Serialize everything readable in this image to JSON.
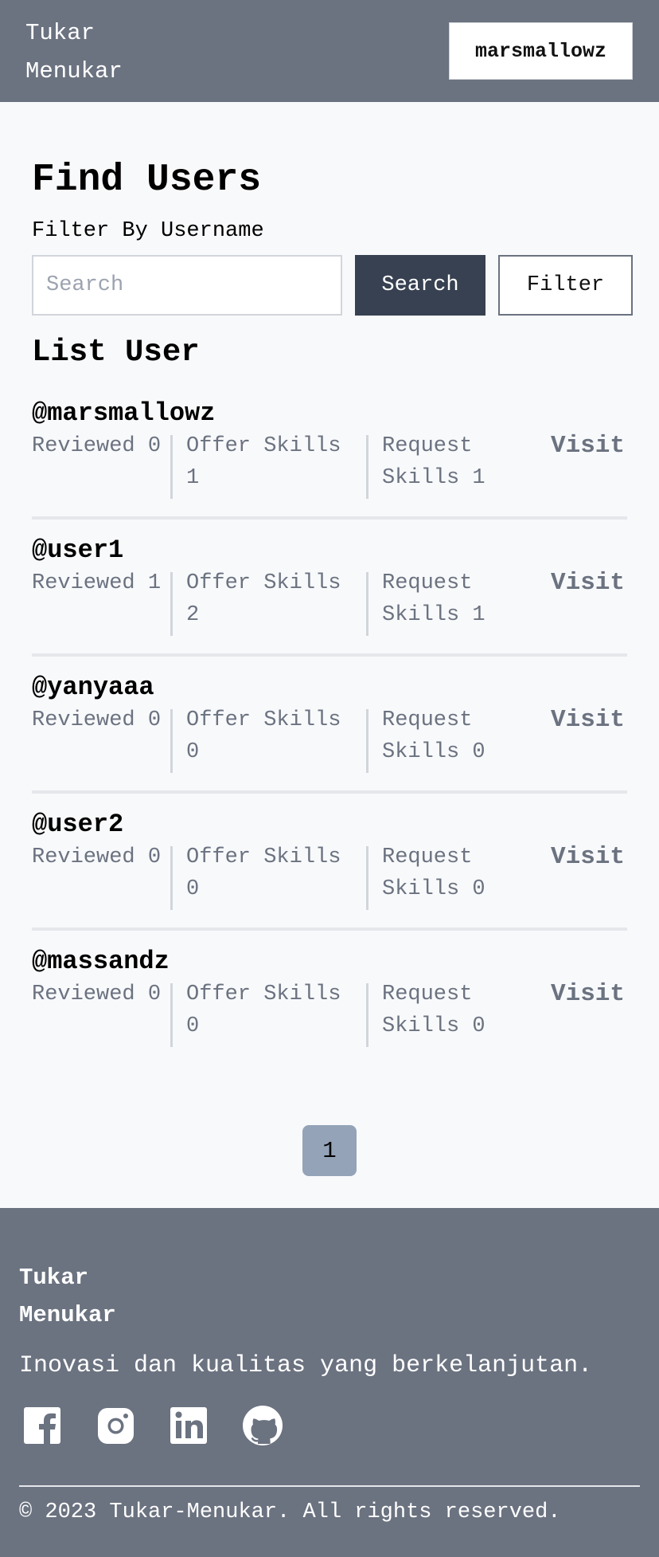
{
  "header": {
    "brand": "Tukar Menukar",
    "user_button": "marsmallowz"
  },
  "find": {
    "title": "Find Users",
    "filter_label": "Filter By Username",
    "search_placeholder": "Search",
    "search_value": "",
    "search_button": "Search",
    "filter_button": "Filter"
  },
  "list": {
    "title": "List User",
    "users": [
      {
        "username": "@marsmallowz",
        "reviewed": "Reviewed 0",
        "offer": "Offer Skills 1",
        "request": "Request Skills 1",
        "visit": "Visit"
      },
      {
        "username": "@user1",
        "reviewed": "Reviewed 1",
        "offer": "Offer Skills 2",
        "request": "Request Skills 1",
        "visit": "Visit"
      },
      {
        "username": "@yanyaaa",
        "reviewed": "Reviewed 0",
        "offer": "Offer Skills 0",
        "request": "Request Skills 0",
        "visit": "Visit"
      },
      {
        "username": "@user2",
        "reviewed": "Reviewed 0",
        "offer": "Offer Skills 0",
        "request": "Request Skills 0",
        "visit": "Visit"
      },
      {
        "username": "@massandz",
        "reviewed": "Reviewed 0",
        "offer": "Offer Skills 0",
        "request": "Request Skills 0",
        "visit": "Visit"
      }
    ]
  },
  "pagination": {
    "current_page": "1"
  },
  "footer": {
    "brand": "Tukar Menukar",
    "tagline": "Inovasi dan kualitas yang berkelanjutan.",
    "socials": [
      "facebook-icon",
      "instagram-icon",
      "linkedin-icon",
      "github-icon"
    ],
    "copyright": "© 2023 Tukar-Menukar. All rights reserved."
  },
  "colors": {
    "header_bg": "#6b7280",
    "search_button_bg": "#374151",
    "page_button_bg": "#94a3b8",
    "page_bg": "#f8f9fb"
  }
}
